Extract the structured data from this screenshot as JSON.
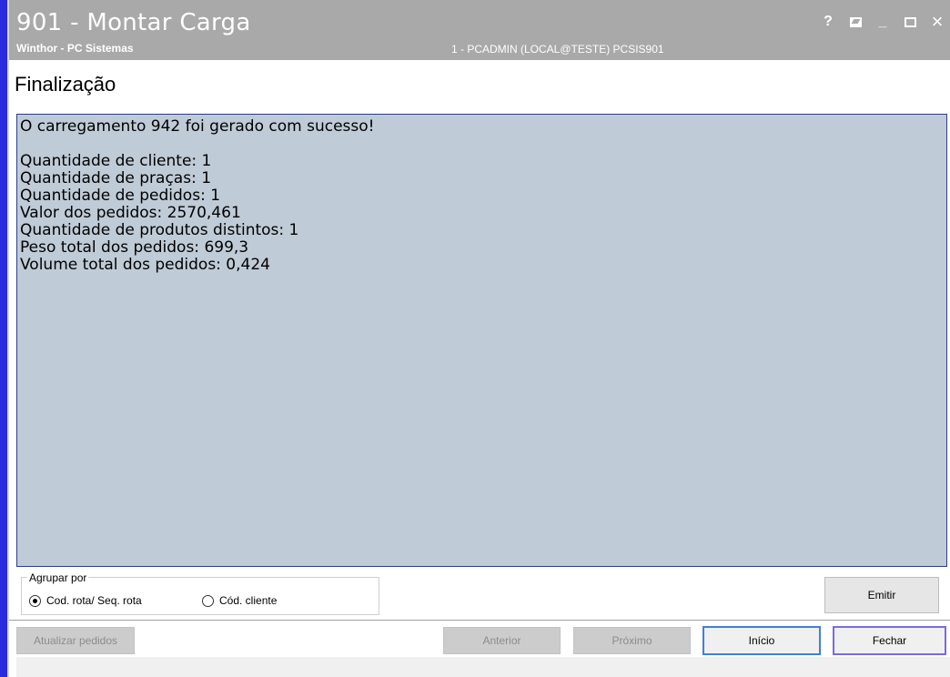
{
  "window": {
    "title": "901 - Montar Carga",
    "subtitle": "Winthor - PC Sistemas",
    "user_info": "1 - PCADMIN (LOCAL@TESTE)  PCSIS901",
    "controls": [
      "help-icon",
      "restore-icon",
      "minimize-icon",
      "maximize-icon",
      "close-icon"
    ],
    "help_label": "?",
    "minimize_label": "_",
    "close_label": "×"
  },
  "page": {
    "title": "Finalização"
  },
  "result": {
    "headline": "O carregamento 942 foi gerado com sucesso!",
    "lines": [
      "Quantidade de cliente: 1",
      "Quantidade de praças: 1",
      "Quantidade de pedidos: 1",
      "Valor dos pedidos: 2570,461",
      "Quantidade de produtos distintos: 1",
      "Peso total dos pedidos: 699,3",
      "Volume total dos pedidos: 0,424"
    ]
  },
  "grouping": {
    "legend": "Agrupar por",
    "options": [
      {
        "label": "Cod. rota/ Seq. rota",
        "selected": true
      },
      {
        "label": "Cód. cliente",
        "selected": false
      }
    ]
  },
  "buttons": {
    "emitir": "Emitir",
    "atualizar_pedidos": "Atualizar pedidos",
    "anterior": "Anterior",
    "proximo": "Próximo",
    "inicio": "Início",
    "fechar": "Fechar"
  },
  "colors": {
    "titlebar": "#a9a9a9",
    "result_bg": "#bfcbd7",
    "window_border": "#2a2adf"
  }
}
